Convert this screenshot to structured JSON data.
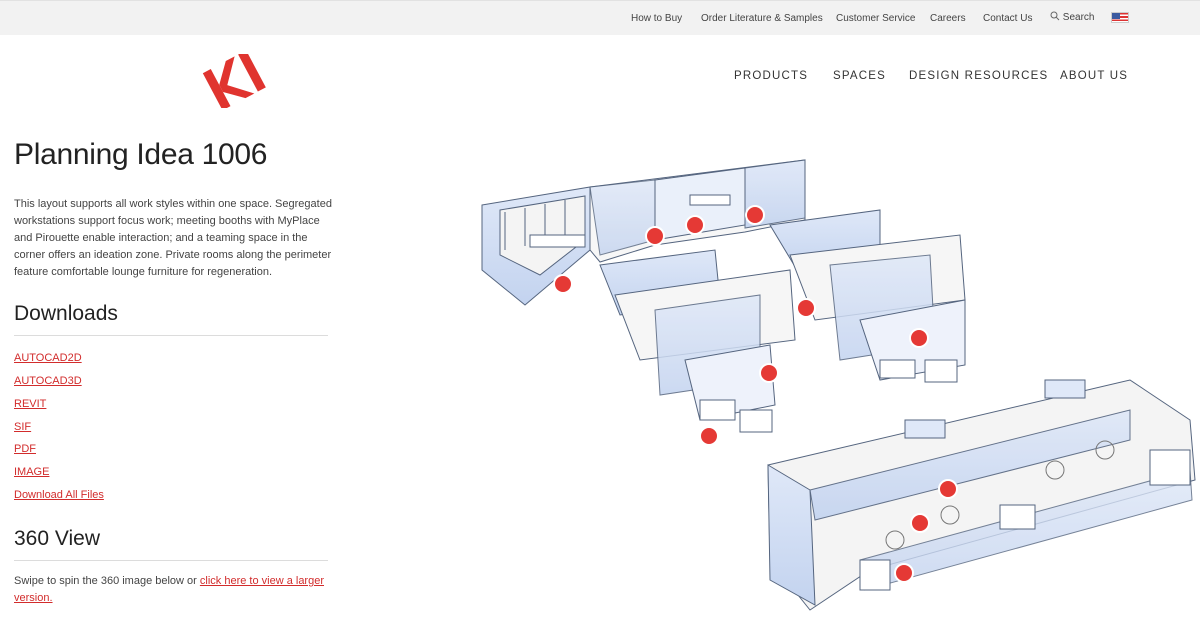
{
  "colors": {
    "accent": "#d22c2c",
    "hotspot": "#e53935",
    "panel": "#cfdcf3",
    "panel_edge": "#5a6e9c"
  },
  "topbar": {
    "links": [
      "How to Buy",
      "Order Literature & Samples",
      "Customer Service",
      "Careers",
      "Contact Us"
    ],
    "search_label": "Search",
    "flag": "us-flag-icon"
  },
  "logo": {
    "text": "KI",
    "icon": "ki-logo"
  },
  "nav": [
    "PRODUCTS",
    "SPACES",
    "DESIGN RESOURCES",
    "ABOUT US"
  ],
  "page": {
    "title": "Planning Idea 1006",
    "description": "This layout supports all work styles within one space. Segregated workstations support focus work; meeting booths with MyPlace and Pirouette enable interaction; and a teaming space in the corner offers an ideation zone. Private rooms along the perimeter feature comfortable lounge furniture for regeneration."
  },
  "downloads": {
    "heading": "Downloads",
    "links": [
      "AUTOCAD2D",
      "AUTOCAD3D",
      "REVIT",
      "SIF",
      "PDF",
      "IMAGE",
      "Download All Files"
    ]
  },
  "view360": {
    "heading": "360 View",
    "text": "Swipe to spin the 360 image below or ",
    "link": "click here to view a larger version."
  },
  "image": {
    "description_icon": "floor-plan-rendering",
    "hotspot_count": 11
  }
}
